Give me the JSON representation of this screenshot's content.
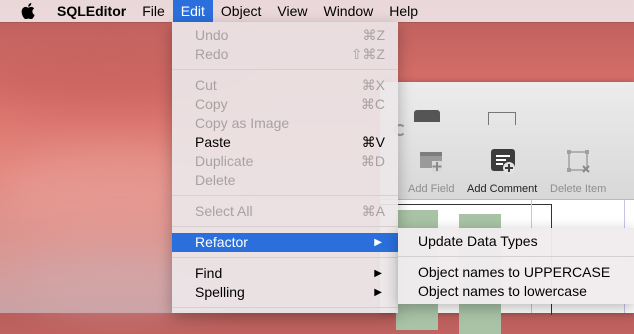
{
  "menubar": {
    "app_name": "SQLEditor",
    "items": [
      "File",
      "Edit",
      "Object",
      "View",
      "Window",
      "Help"
    ]
  },
  "edit_menu": {
    "items": [
      {
        "label": "Undo",
        "shortcut": "⌘Z",
        "enabled": false
      },
      {
        "label": "Redo",
        "shortcut": "⇧⌘Z",
        "enabled": false
      },
      {
        "label": "Cut",
        "shortcut": "⌘X",
        "enabled": false
      },
      {
        "label": "Copy",
        "shortcut": "⌘C",
        "enabled": false
      },
      {
        "label": "Copy as Image",
        "shortcut": "",
        "enabled": false
      },
      {
        "label": "Paste",
        "shortcut": "⌘V",
        "enabled": true
      },
      {
        "label": "Duplicate",
        "shortcut": "⌘D",
        "enabled": false
      },
      {
        "label": "Delete",
        "shortcut": "",
        "enabled": false
      },
      {
        "label": "Select All",
        "shortcut": "⌘A",
        "enabled": false
      },
      {
        "label": "Refactor",
        "shortcut": "",
        "enabled": true,
        "highlighted": true,
        "submenu": true
      },
      {
        "label": "Find",
        "shortcut": "",
        "enabled": true,
        "submenu": true
      },
      {
        "label": "Spelling",
        "shortcut": "",
        "enabled": true,
        "submenu": true
      }
    ]
  },
  "refactor_submenu": {
    "items": [
      "Update Data Types",
      "Object names to UPPERCASE",
      "Object names to lowercase"
    ]
  },
  "toolbar": {
    "partial_label": "e",
    "add_field": "Add Field",
    "add_comment": "Add Comment",
    "delete_item": "Delete Item"
  },
  "colors": {
    "highlight": "#2b6fdc",
    "disabled_text": "#a8a1a3"
  }
}
